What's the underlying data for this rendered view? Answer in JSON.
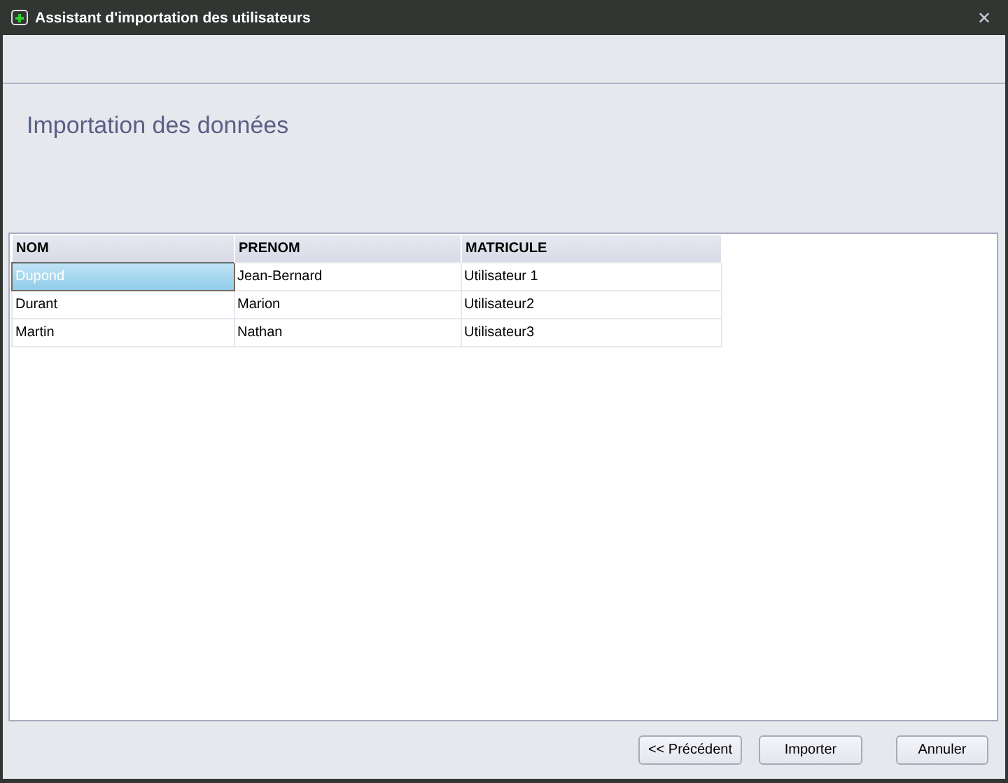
{
  "window": {
    "title": "Assistant d'importation des utilisateurs",
    "close": "✕"
  },
  "heading": "Importation des données",
  "table": {
    "columns": [
      "NOM",
      "PRENOM",
      "MATRICULE"
    ],
    "rows": [
      {
        "cells": [
          "Dupond",
          "Jean-Bernard",
          "Utilisateur 1"
        ],
        "selected": true
      },
      {
        "cells": [
          "Durant",
          "Marion",
          "Utilisateur2"
        ],
        "selected": false
      },
      {
        "cells": [
          "Martin",
          "Nathan",
          "Utilisateur3"
        ],
        "selected": false
      }
    ]
  },
  "buttons": [
    "<< Précédent",
    "Importer",
    "Annuler"
  ]
}
